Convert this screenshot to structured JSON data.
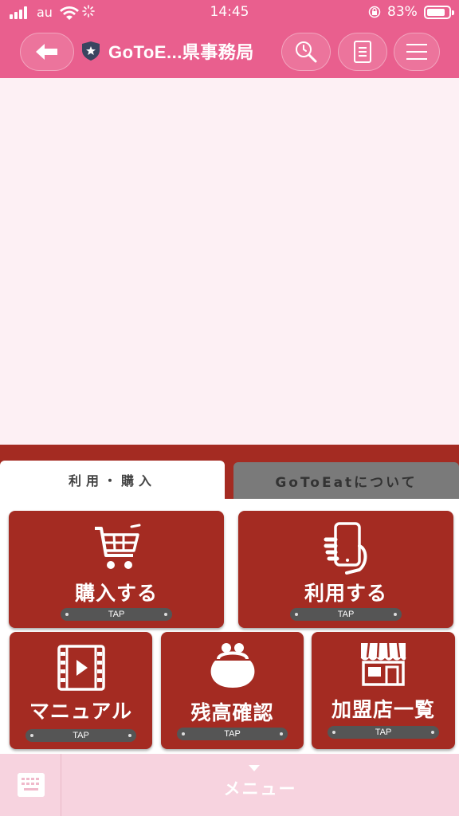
{
  "status_bar": {
    "carrier": "au",
    "time": "14:45",
    "battery_pct": "83%"
  },
  "header": {
    "title": "GoToE...県事務局",
    "icons": [
      "back-arrow-icon",
      "shield-star-icon",
      "search-history-icon",
      "document-icon",
      "hamburger-menu-icon"
    ]
  },
  "tabs": [
    {
      "label": "利用・購入",
      "active": true
    },
    {
      "label": "GoToEatについて",
      "active": false
    }
  ],
  "cards": [
    {
      "label": "購入する",
      "tap": "TAP",
      "icon": "shopping-cart-icon"
    },
    {
      "label": "利用する",
      "tap": "TAP",
      "icon": "smartphone-hand-icon"
    },
    {
      "label": "マニュアル",
      "tap": "TAP",
      "icon": "video-film-icon"
    },
    {
      "label": "残高確認",
      "tap": "TAP",
      "icon": "coin-purse-icon"
    },
    {
      "label": "加盟店一覧",
      "tap": "TAP",
      "icon": "storefront-icon"
    }
  ],
  "bottom": {
    "menu_label": "メニュー",
    "icon": "keyboard-icon"
  },
  "colors": {
    "header": "#e95f8e",
    "content_bg": "#fdf0f4",
    "card": "#a42b22",
    "tab_inactive": "#7a7a7a",
    "bottom_bar": "#f7d3df"
  }
}
